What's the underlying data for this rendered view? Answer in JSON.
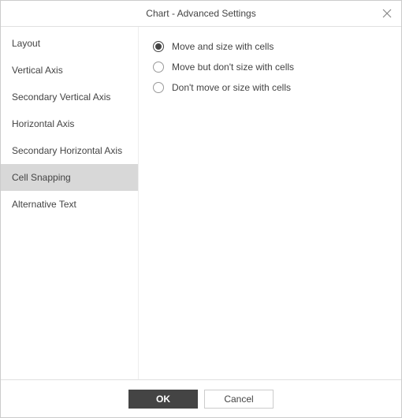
{
  "header": {
    "title": "Chart - Advanced Settings"
  },
  "sidebar": {
    "items": [
      {
        "label": "Layout"
      },
      {
        "label": "Vertical Axis"
      },
      {
        "label": "Secondary Vertical Axis"
      },
      {
        "label": "Horizontal Axis"
      },
      {
        "label": "Secondary Horizontal Axis"
      },
      {
        "label": "Cell Snapping"
      },
      {
        "label": "Alternative Text"
      }
    ],
    "active_index": 5
  },
  "content": {
    "radios": [
      {
        "label": "Move and size with cells"
      },
      {
        "label": "Move but don't size with cells"
      },
      {
        "label": "Don't move or size with cells"
      }
    ],
    "selected_index": 0
  },
  "footer": {
    "ok_label": "OK",
    "cancel_label": "Cancel"
  }
}
